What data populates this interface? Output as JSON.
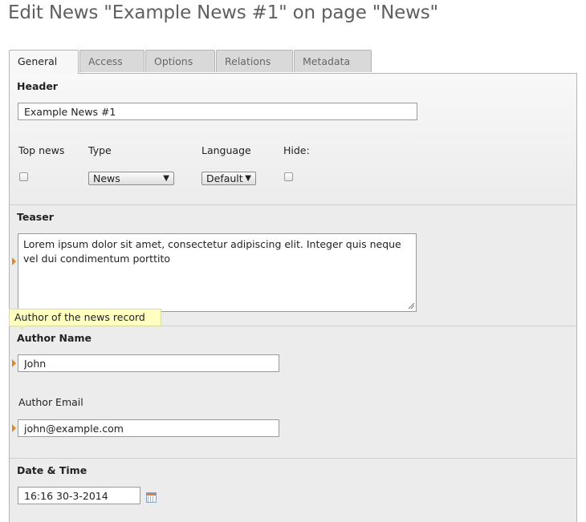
{
  "page": {
    "title": "Edit News \"Example News #1\" on page \"News\""
  },
  "tabs": [
    "General",
    "Access",
    "Options",
    "Relations",
    "Metadata"
  ],
  "header_section": {
    "heading": "Header",
    "header_value": "Example News #1",
    "labels": {
      "top_news": "Top news",
      "type": "Type",
      "language": "Language",
      "hide": "Hide:"
    },
    "type_selected": "News",
    "language_selected": "Default"
  },
  "teaser_section": {
    "heading": "Teaser",
    "teaser_text": "Lorem ipsum dolor sit amet, consectetur adipiscing elit. Integer quis neque vel dui condimentum porttito"
  },
  "tooltip": {
    "text": "Author of the news record"
  },
  "author_section": {
    "heading": "Author Name",
    "author_name": "John",
    "email_label": "Author Email",
    "author_email": "john@example.com"
  },
  "datetime_section": {
    "heading": "Date & Time",
    "datetime_value": "16:16 30-3-2014"
  },
  "colors": {
    "marker": "#d9892b",
    "tooltip_bg": "#ffffc2",
    "panel_bg": "#ececec"
  }
}
